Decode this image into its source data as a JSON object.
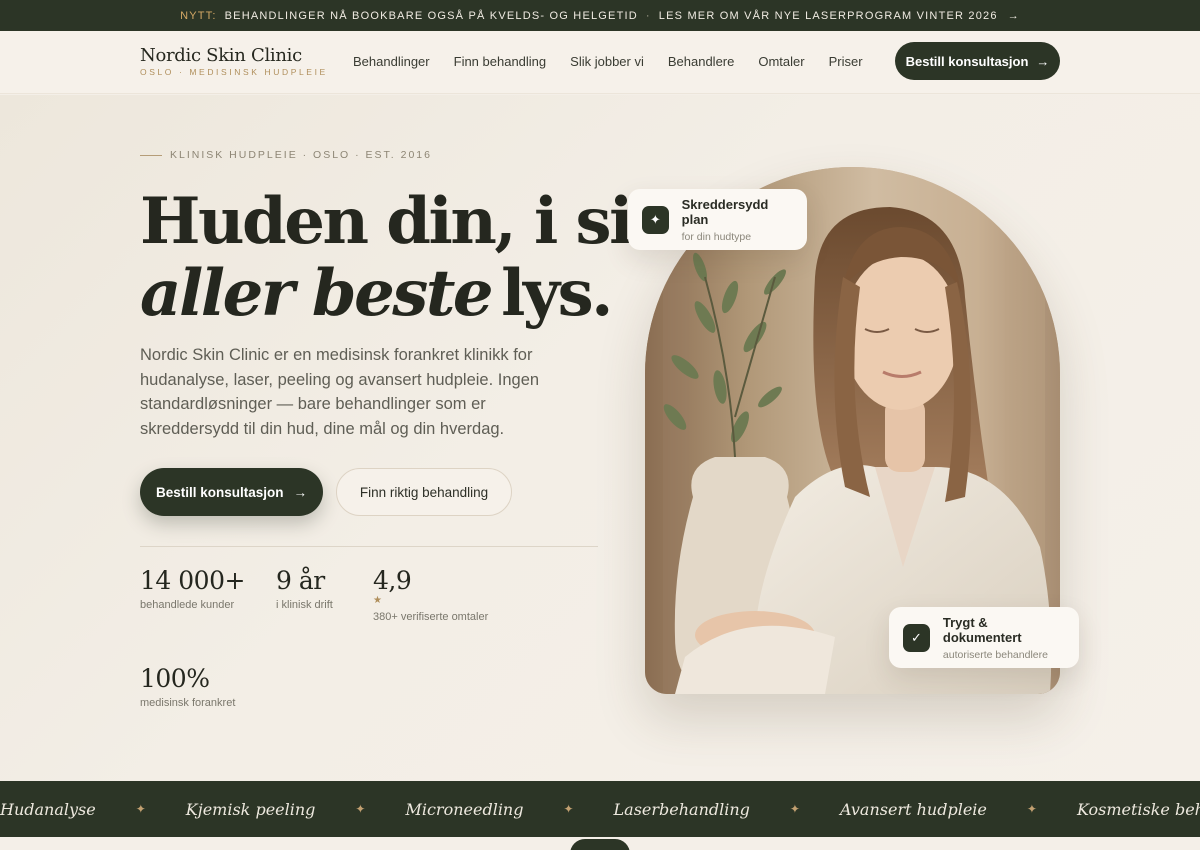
{
  "announcement": {
    "tag": "NYTT:",
    "message": "BEHANDLINGER NÅ BOOKBARE OGSÅ PÅ KVELDS- OG HELGETID",
    "separator": "·",
    "link": "LES MER OM VÅR NYE LASERPROGRAM VINTER 2026",
    "arrow": "→"
  },
  "nav": {
    "brand_name": "Nordic Skin Clinic",
    "brand_sub": "OSLO · MEDISINSK HUDPLEIE",
    "items": [
      "Behandlinger",
      "Finn behandling",
      "Slik jobber vi",
      "Behandlere",
      "Omtaler",
      "Priser"
    ],
    "cta_label": "Bestill konsultasjon",
    "cta_arrow": "→"
  },
  "hero": {
    "eyebrow": "KLINISK HUDPLEIE · OSLO · EST. 2016",
    "title_line1": "Huden din, i sitt",
    "title_emphasis": "aller beste",
    "title_rest": "lys.",
    "lead": "Nordic Skin Clinic er en medisinsk forankret klinikk for hudanalyse, laser, peeling og avansert hudpleie. Ingen standardløsninger — bare behandlinger som er skreddersydd til din hud, dine mål og din hverdag.",
    "primary_label": "Bestill konsultasjon",
    "primary_arrow": "→",
    "secondary_label": "Finn riktig behandling"
  },
  "stats": [
    {
      "value": "14 000+",
      "label": "behandlede kunder"
    },
    {
      "value": "9 år",
      "label": "i klinisk drift"
    },
    {
      "value": "4,9",
      "star": "★",
      "label": "380+ verifiserte omtaler"
    },
    {
      "value": "100%",
      "label": "medisinsk forankret"
    }
  ],
  "badges": {
    "top": {
      "icon": "✦",
      "title": "Skreddersydd plan",
      "subtitle": "for din hudtype"
    },
    "bottom": {
      "icon": "✓",
      "title": "Trygt & dokumentert",
      "subtitle": "autoriserte behandlere"
    }
  },
  "marquee": {
    "items": [
      "Hudanalyse",
      "Kjemisk peeling",
      "Microneedling",
      "Laserbehandling",
      "Avansert hudpleie",
      "Kosmetiske behandlinger"
    ],
    "separator": "✦"
  },
  "colors": {
    "dark_green": "#2c3526",
    "background": "#f4efe8",
    "gold": "#b08f5c"
  }
}
